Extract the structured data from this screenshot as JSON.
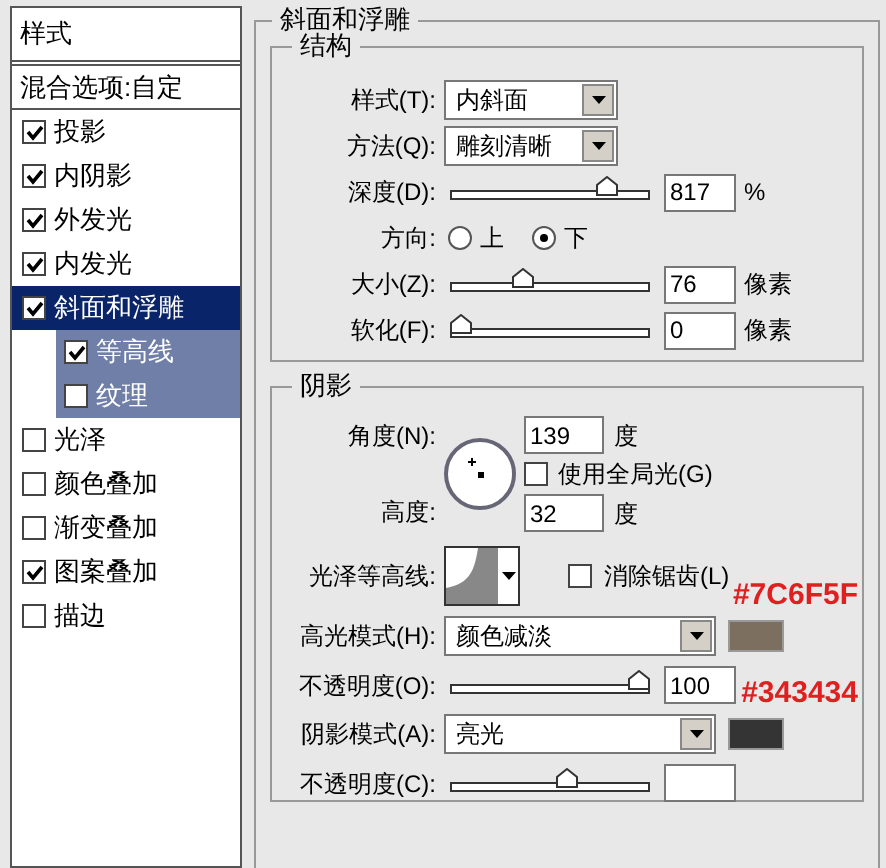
{
  "sidebar": {
    "header": "样式",
    "blending": "混合选项:自定",
    "items": [
      {
        "kind": "top",
        "label": "投影",
        "checked": true,
        "selected": false
      },
      {
        "kind": "top",
        "label": "内阴影",
        "checked": true,
        "selected": false
      },
      {
        "kind": "top",
        "label": "外发光",
        "checked": true,
        "selected": false
      },
      {
        "kind": "top",
        "label": "内发光",
        "checked": true,
        "selected": false
      },
      {
        "kind": "top",
        "label": "斜面和浮雕",
        "checked": true,
        "selected": true
      },
      {
        "kind": "sub",
        "label": "等高线",
        "checked": true,
        "selected": false
      },
      {
        "kind": "sub",
        "label": "纹理",
        "checked": false,
        "selected": false
      },
      {
        "kind": "top",
        "label": "光泽",
        "checked": false,
        "selected": false
      },
      {
        "kind": "top",
        "label": "颜色叠加",
        "checked": false,
        "selected": false
      },
      {
        "kind": "top",
        "label": "渐变叠加",
        "checked": false,
        "selected": false
      },
      {
        "kind": "top",
        "label": "图案叠加",
        "checked": true,
        "selected": false
      },
      {
        "kind": "top",
        "label": "描边",
        "checked": false,
        "selected": false
      }
    ]
  },
  "panel": {
    "title": "斜面和浮雕",
    "structure": {
      "title": "结构",
      "rows": [
        {
          "kind": "dropdown",
          "label": "样式(T):",
          "value": "内斜面"
        },
        {
          "kind": "dropdown",
          "label": "方法(Q):",
          "value": "雕刻清晰"
        },
        {
          "kind": "slider",
          "label": "深度(D):",
          "level": 0.82,
          "value": "817",
          "unit": "%"
        },
        {
          "kind": "radio",
          "label": "方向:",
          "options": [
            {
              "label": "上",
              "selected": false
            },
            {
              "label": "下",
              "selected": true
            }
          ]
        },
        {
          "kind": "slider",
          "label": "大小(Z):",
          "level": 0.35,
          "value": "76",
          "unit": "像素"
        },
        {
          "kind": "slider",
          "label": "软化(F):",
          "level": 0,
          "value": "0",
          "unit": "像素"
        }
      ]
    },
    "shading": {
      "title": "阴影",
      "angle": {
        "label": "角度(N):",
        "value": "139",
        "unit": "度"
      },
      "global_light": {
        "label": "使用全局光(G)",
        "checked": false
      },
      "altitude": {
        "label": "高度:",
        "value": "32",
        "unit": "度"
      },
      "gloss_contour": {
        "label": "光泽等高线:"
      },
      "anti_alias": {
        "label": "消除锯齿(L)",
        "checked": false
      },
      "rows": [
        {
          "kind": "mode",
          "label": "高光模式(H):",
          "value": "颜色减淡",
          "color": "#7c6f5f",
          "annotation": "#7C6F5F"
        },
        {
          "kind": "slider",
          "label": "不透明度(O):",
          "level": 1,
          "value": "100"
        },
        {
          "kind": "mode",
          "label": "阴影模式(A):",
          "value": "亮光",
          "color": "#343434",
          "annotation": "#343434"
        },
        {
          "kind": "slider",
          "label": "不透明度(C):",
          "level": 0.6
        }
      ]
    }
  }
}
